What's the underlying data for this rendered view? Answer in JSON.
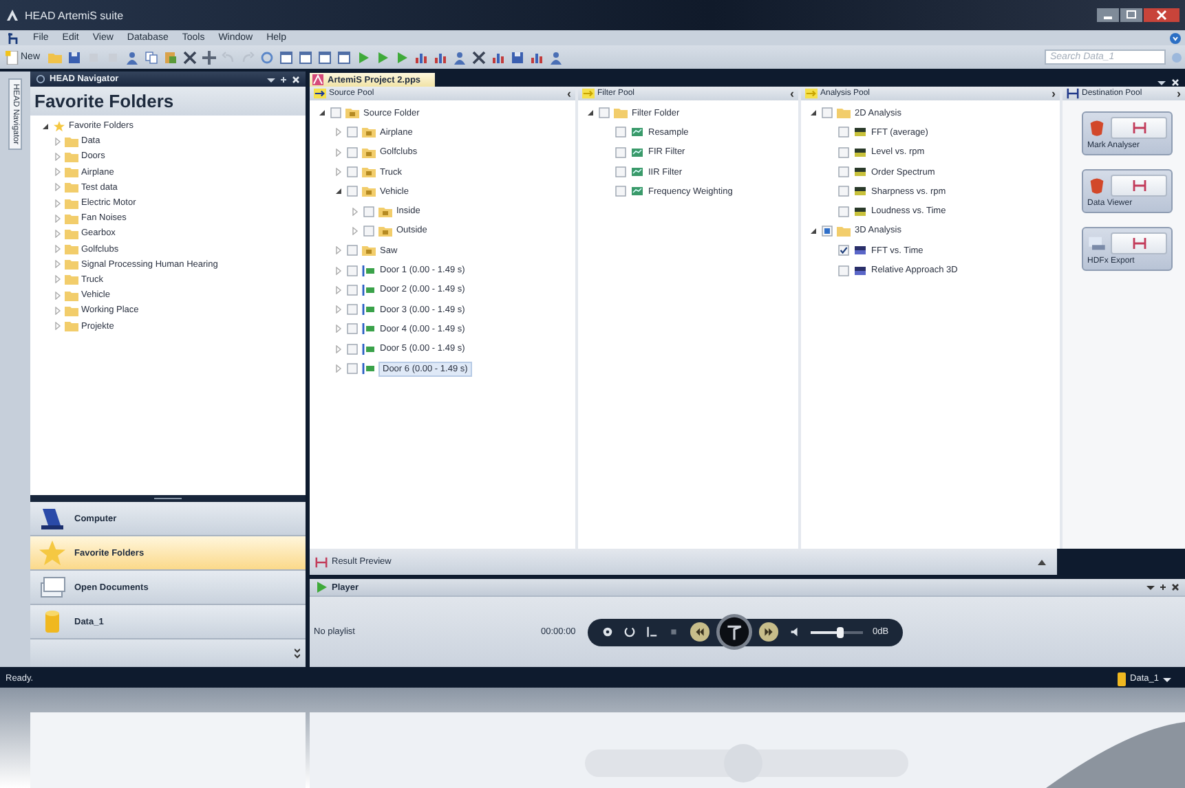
{
  "window": {
    "title": "HEAD ArtemiS suite"
  },
  "menu": [
    "File",
    "Edit",
    "View",
    "Database",
    "Tools",
    "Window",
    "Help"
  ],
  "toolbar": {
    "new_label": "New",
    "search": {
      "placeholder": "Search Data_1"
    }
  },
  "navigator": {
    "title": "HEAD Navigator",
    "side_tab": "HEAD Navigator",
    "heading": "Favorite Folders",
    "tree": [
      {
        "label": "Favorite Folders",
        "kind": "star",
        "expanded": true,
        "children": [
          {
            "label": "Data",
            "kind": "folder",
            "expanded": false
          },
          {
            "label": "Doors",
            "kind": "folder",
            "expanded": false
          },
          {
            "label": "Airplane",
            "kind": "folder",
            "expanded": false
          },
          {
            "label": "Test data",
            "kind": "folder",
            "expanded": false
          },
          {
            "label": "Electric Motor",
            "kind": "folder",
            "expanded": false
          },
          {
            "label": "Fan Noises",
            "kind": "folder",
            "expanded": false
          },
          {
            "label": "Gearbox",
            "kind": "folder",
            "expanded": false
          },
          {
            "label": "Golfclubs",
            "kind": "folder",
            "expanded": false
          },
          {
            "label": "Signal Processing Human Hearing",
            "kind": "folder",
            "expanded": false
          },
          {
            "label": "Truck",
            "kind": "folder",
            "expanded": false
          },
          {
            "label": "Vehicle",
            "kind": "folder",
            "expanded": false
          },
          {
            "label": "Working Place",
            "kind": "folder",
            "expanded": false
          },
          {
            "label": "Projekte",
            "kind": "folder",
            "expanded": false
          }
        ]
      }
    ],
    "buttons": [
      {
        "label": "Computer",
        "kind": "computer",
        "selected": false
      },
      {
        "label": "Favorite Folders",
        "kind": "star",
        "selected": true
      },
      {
        "label": "Open Documents",
        "kind": "documents",
        "selected": false
      },
      {
        "label": "Data_1",
        "kind": "database",
        "selected": false
      }
    ]
  },
  "document": {
    "tab": "ArtemiS Project 2.pps"
  },
  "pools": [
    {
      "title": "Source Pool",
      "kind": "source",
      "arrow": "‹",
      "tree": [
        {
          "label": "Source Folder",
          "kind": "sound-folder",
          "expanded": true,
          "checked": false,
          "selected": false,
          "children": [
            {
              "label": "Airplane",
              "kind": "sound-folder",
              "expanded": false,
              "checked": false,
              "selected": false
            },
            {
              "label": "Golfclubs",
              "kind": "sound-folder",
              "expanded": false,
              "checked": false,
              "selected": false
            },
            {
              "label": "Truck",
              "kind": "sound-folder",
              "expanded": false,
              "checked": false,
              "selected": false
            },
            {
              "label": "Vehicle",
              "kind": "sound-folder",
              "expanded": true,
              "checked": false,
              "selected": false,
              "children": [
                {
                  "label": "Inside",
                  "kind": "sound-folder",
                  "expanded": false,
                  "checked": false,
                  "selected": false
                },
                {
                  "label": "Outside",
                  "kind": "sound-folder",
                  "expanded": false,
                  "checked": false,
                  "selected": false
                }
              ]
            },
            {
              "label": "Saw",
              "kind": "sound-folder",
              "expanded": false,
              "checked": false,
              "selected": false
            },
            {
              "label": "Door 1  (0.00 - 1.49 s)",
              "kind": "signal",
              "expanded": false,
              "checked": false,
              "selected": false
            },
            {
              "label": "Door 2  (0.00 - 1.49 s)",
              "kind": "signal",
              "expanded": false,
              "checked": false,
              "selected": false
            },
            {
              "label": "Door 3  (0.00 - 1.49 s)",
              "kind": "signal",
              "expanded": false,
              "checked": false,
              "selected": false
            },
            {
              "label": "Door 4  (0.00 - 1.49 s)",
              "kind": "signal",
              "expanded": false,
              "checked": false,
              "selected": false
            },
            {
              "label": "Door 5  (0.00 - 1.49 s)",
              "kind": "signal",
              "expanded": false,
              "checked": false,
              "selected": false
            },
            {
              "label": "Door 6  (0.00 - 1.49 s)",
              "kind": "signal",
              "expanded": false,
              "checked": false,
              "selected": true
            }
          ]
        }
      ]
    },
    {
      "title": "Filter Pool",
      "kind": "filter",
      "arrow": "‹",
      "tree": [
        {
          "label": "Filter Folder",
          "kind": "folder",
          "expanded": true,
          "checked": false,
          "children": [
            {
              "label": "Resample",
              "kind": "filter",
              "checked": false
            },
            {
              "label": "FIR Filter",
              "kind": "filter",
              "checked": false
            },
            {
              "label": "IIR Filter",
              "kind": "filter",
              "checked": false
            },
            {
              "label": "Frequency Weighting",
              "kind": "filter",
              "checked": false
            }
          ]
        }
      ]
    },
    {
      "title": "Analysis Pool",
      "kind": "analysis",
      "arrow": "›",
      "tree": [
        {
          "label": "2D Analysis",
          "kind": "folder",
          "expanded": true,
          "checked": false,
          "indeterminate": false,
          "children": [
            {
              "label": "FFT (average)",
              "kind": "analysis2d",
              "checked": false
            },
            {
              "label": "Level vs. rpm",
              "kind": "analysis2d",
              "checked": false
            },
            {
              "label": "Order Spectrum",
              "kind": "analysis2d",
              "checked": false
            },
            {
              "label": "Sharpness vs. rpm",
              "kind": "analysis2d",
              "checked": false
            },
            {
              "label": "Loudness vs. Time",
              "kind": "analysis2d",
              "checked": false
            }
          ]
        },
        {
          "label": "3D Analysis",
          "kind": "folder",
          "expanded": true,
          "checked": false,
          "indeterminate": true,
          "children": [
            {
              "label": "FFT vs. Time",
              "kind": "analysis3d",
              "checked": true
            },
            {
              "label": "Relative Approach 3D",
              "kind": "analysis3d",
              "checked": false
            }
          ]
        }
      ]
    }
  ],
  "destination": {
    "title": "Destination Pool",
    "arrow": "›",
    "tiles": [
      {
        "label": "Mark Analyser",
        "kind": "analyser"
      },
      {
        "label": "Data Viewer",
        "kind": "viewer"
      },
      {
        "label": "HDFx Export",
        "kind": "export"
      }
    ]
  },
  "result_preview": {
    "title": "Result Preview"
  },
  "player": {
    "title": "Player",
    "playlist": "No playlist",
    "time": "00:00:00",
    "volume": {
      "level": 0.55,
      "reading": "0dB"
    }
  },
  "status_bar": {
    "text": "Ready.",
    "database": "Data_1"
  }
}
